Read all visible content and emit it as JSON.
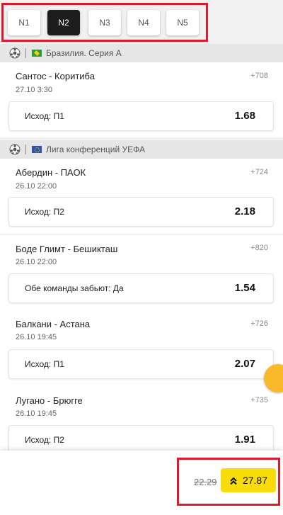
{
  "tabs": [
    "N1",
    "N2",
    "N3",
    "N4",
    "N5"
  ],
  "active_tab": "N2",
  "sections": [
    {
      "league": "Бразилия. Серия А",
      "flag": "brazil",
      "matches": [
        {
          "teams": "Сантос - Коритиба",
          "date": "27.10 3:30",
          "more": "+708",
          "outcome": "Исход: П1",
          "odds": "1.68"
        }
      ]
    },
    {
      "league": "Лига конференций УЕФА",
      "flag": "eu",
      "matches": [
        {
          "teams": "Абердин - ПАОК",
          "date": "26.10 22:00",
          "more": "+724",
          "outcome": "Исход: П2",
          "odds": "2.18"
        },
        {
          "teams": "Боде Глимт - Бешикташ",
          "date": "26.10 22:00",
          "more": "+820",
          "outcome": "Обе команды забьют: Да",
          "odds": "1.54"
        },
        {
          "teams": "Балкани - Астана",
          "date": "26.10 19:45",
          "more": "+726",
          "outcome": "Исход: П1",
          "odds": "2.07"
        },
        {
          "teams": "Лугано - Брюгге",
          "date": "26.10 19:45",
          "more": "+735",
          "outcome": "Исход: П2",
          "odds": "1.91"
        }
      ]
    }
  ],
  "bottom": {
    "old_total": "22.29",
    "new_total": "27.87"
  },
  "colors": {
    "highlight": "#e0182d",
    "accent_yellow": "#f9dd0a",
    "active_tab": "#1d1d1d"
  }
}
